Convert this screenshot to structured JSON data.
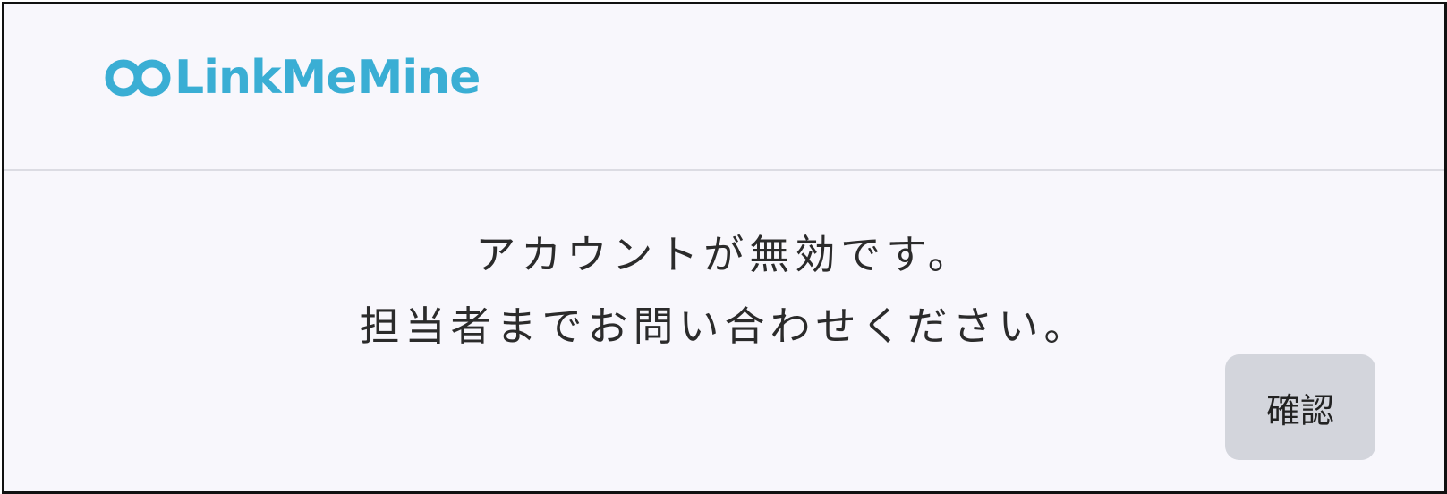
{
  "header": {
    "logo_text": "LinkMeMine"
  },
  "message": {
    "line1": "アカウントが無効です。",
    "line2": "担当者までお問い合わせください。"
  },
  "actions": {
    "confirm_label": "確認"
  },
  "colors": {
    "brand": "#3aaed4",
    "button_bg": "#d3d5dc",
    "dialog_bg": "#f8f7fc"
  }
}
